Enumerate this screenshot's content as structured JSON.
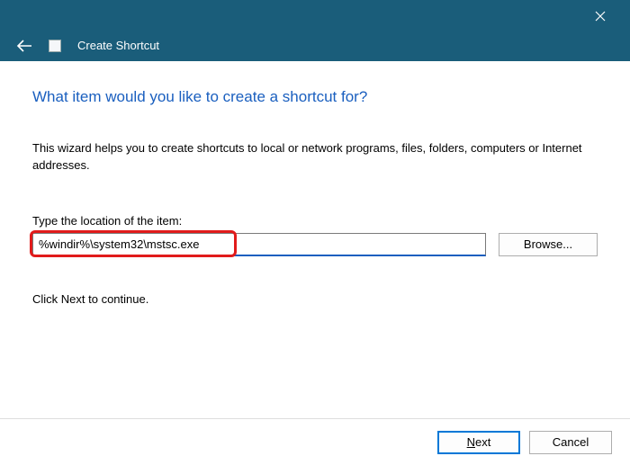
{
  "titlebar": {
    "title": "Create Shortcut"
  },
  "main": {
    "heading": "What item would you like to create a shortcut for?",
    "description": "This wizard helps you to create shortcuts to local or network programs, files, folders, computers or Internet addresses.",
    "locationLabel": "Type the location of the item:",
    "locationValue": "%windir%\\system32\\mstsc.exe",
    "browseLabel": "Browse...",
    "continueText": "Click Next to continue."
  },
  "footer": {
    "nextPrefix": "N",
    "nextSuffix": "ext",
    "cancelLabel": "Cancel"
  }
}
